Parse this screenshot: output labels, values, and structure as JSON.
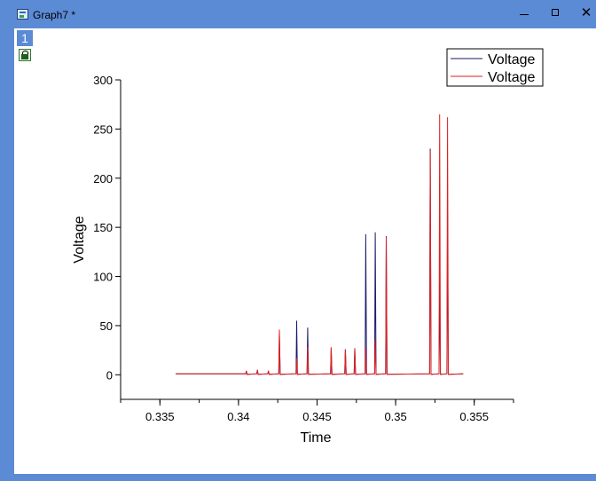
{
  "window": {
    "title": "Graph7 *",
    "controls": {
      "minimize": "minimize",
      "maximize": "maximize",
      "close": "✕"
    }
  },
  "layer": {
    "number": "1"
  },
  "colors": {
    "titlebar": "#5b8bd5",
    "series1": "#1a1a6e",
    "series2": "#e02020"
  },
  "chart_data": {
    "type": "line",
    "title": "",
    "xlabel": "Time",
    "ylabel": "Voltage",
    "xlim": [
      0.3325,
      0.3575
    ],
    "ylim": [
      -25,
      300
    ],
    "x_ticks": [
      0.335,
      0.34,
      0.345,
      0.35,
      0.355
    ],
    "x_tick_labels": [
      "0.335",
      "0.34",
      "0.345",
      "0.35",
      "0.355"
    ],
    "y_ticks": [
      0,
      50,
      100,
      150,
      200,
      250,
      300
    ],
    "y_tick_labels": [
      "0",
      "50",
      "100",
      "150",
      "200",
      "250",
      "300"
    ],
    "legend_position": "top-right",
    "grid": false,
    "series": [
      {
        "name": "Voltage",
        "color": "#1a1a6e",
        "baseline": 1,
        "x_range": [
          0.336,
          0.3543
        ],
        "peaks": [
          {
            "x": 0.3405,
            "y": 4
          },
          {
            "x": 0.3412,
            "y": 5
          },
          {
            "x": 0.3419,
            "y": 4
          },
          {
            "x": 0.3426,
            "y": 42
          },
          {
            "x": 0.3437,
            "y": 55
          },
          {
            "x": 0.3444,
            "y": 48
          },
          {
            "x": 0.3459,
            "y": 27
          },
          {
            "x": 0.3468,
            "y": 26
          },
          {
            "x": 0.3474,
            "y": 27
          },
          {
            "x": 0.3481,
            "y": 143
          },
          {
            "x": 0.3487,
            "y": 145
          },
          {
            "x": 0.3494,
            "y": 141
          },
          {
            "x": 0.3522,
            "y": 230
          },
          {
            "x": 0.3528,
            "y": 95
          },
          {
            "x": 0.3533,
            "y": 165
          }
        ]
      },
      {
        "name": "Voltage",
        "color": "#e02020",
        "baseline": 1,
        "x_range": [
          0.336,
          0.3543
        ],
        "peaks": [
          {
            "x": 0.3405,
            "y": 4
          },
          {
            "x": 0.3412,
            "y": 5
          },
          {
            "x": 0.3419,
            "y": 4
          },
          {
            "x": 0.3426,
            "y": 46
          },
          {
            "x": 0.3437,
            "y": 17
          },
          {
            "x": 0.3444,
            "y": 28
          },
          {
            "x": 0.3459,
            "y": 28
          },
          {
            "x": 0.3468,
            "y": 26
          },
          {
            "x": 0.3474,
            "y": 27
          },
          {
            "x": 0.3481,
            "y": 28
          },
          {
            "x": 0.3487,
            "y": 36
          },
          {
            "x": 0.3494,
            "y": 140
          },
          {
            "x": 0.3522,
            "y": 228
          },
          {
            "x": 0.3528,
            "y": 265
          },
          {
            "x": 0.3533,
            "y": 262
          }
        ]
      }
    ]
  }
}
